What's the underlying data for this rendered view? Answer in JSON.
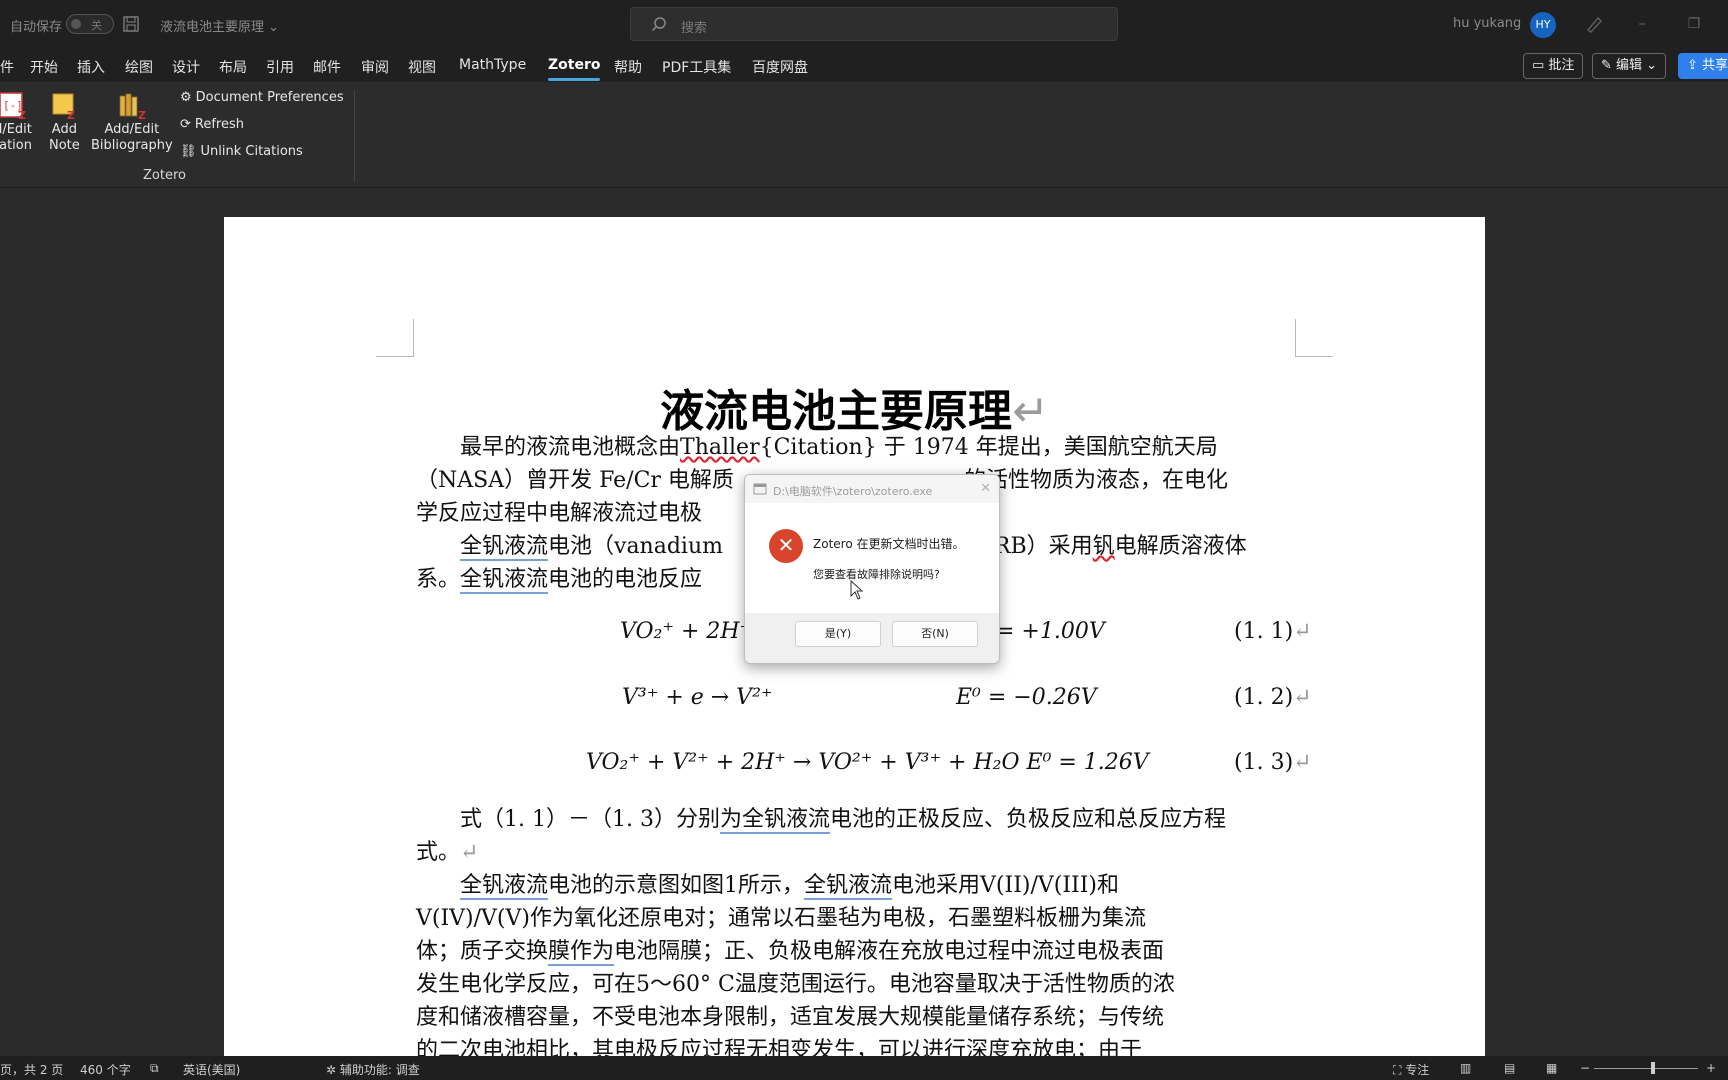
{
  "titlebar": {
    "autosave_label": "自动保存",
    "autosave_state": "关",
    "doc_name": "液流电池主要原理",
    "search_placeholder": "搜索",
    "user_name": "hu yukang",
    "avatar_initials": "HY"
  },
  "menu": {
    "items": [
      "件",
      "开始",
      "插入",
      "绘图",
      "设计",
      "布局",
      "引用",
      "邮件",
      "审阅",
      "视图",
      "MathType",
      "Zotero",
      "帮助",
      "PDF工具集",
      "百度网盘"
    ],
    "active": "Zotero",
    "comments_label": "批注",
    "edit_label": "编辑",
    "share_label": "共享"
  },
  "ribbon": {
    "add_edit_citation": [
      "d/Edit",
      "tation"
    ],
    "add_note": [
      "Add",
      "Note"
    ],
    "add_edit_bibliography": [
      "Add/Edit",
      "Bibliography"
    ],
    "document_preferences": "Document Preferences",
    "refresh": "Refresh",
    "unlink_citations": "Unlink Citations",
    "group_label": "Zotero"
  },
  "document": {
    "title": "液流电池主要原理",
    "p1_line1_a": "最早的液流电池概念由",
    "p1_line1_thaller": "Thaller",
    "p1_line1_b": "{Citation}",
    "p1_line1_c": "于 1974 年提出，美国航空航天局",
    "p1_line2_a": "（NASA）曾开发 Fe/Cr 电解质",
    "p1_line2_b": "的活性物质为液态，在电化",
    "p1_line3": "学反应过程中电解液流过电极",
    "p2_line1_a": "全钒液流",
    "p2_line1_b": "电池（vanadium",
    "p2_line1_c": "VRB）采用",
    "p2_line1_d": "钒",
    "p2_line1_e": "电解质溶液体",
    "p2_line2_a": "系。",
    "p2_line2_b": "全钒液流",
    "p2_line2_c": "电池的电池反应",
    "eq1_left": "VO₂⁺ + 2H⁺",
    "eq1_right": "= +1.00V",
    "eq1_no": "(1. 1)",
    "eq2_left": "V³⁺ + e → V²⁺",
    "eq2_right": "E⁰ = −0.26V",
    "eq2_no": "(1. 2)",
    "eq3": "VO₂⁺ + V²⁺ + 2H⁺ → VO²⁺ + V³⁺ + H₂O    E⁰ = 1.26V",
    "eq3_no": "(1. 3)",
    "p3_line1_a": "式（1. 1）－（1. 3）分别",
    "p3_line1_b": "为全钒液流",
    "p3_line1_c": "电池的正极反应、负极反应和总反应方程",
    "p3_line2": "式。",
    "p4_line1_a": "全钒液流",
    "p4_line1_b": "电池的示意图如图1所示，",
    "p4_line1_c": "全钒液流",
    "p4_line1_d": "电池采用V(II)/V(III)和",
    "p4_line2": "V(IV)/V(V)作为氧化还原电对；通常以石墨毡为电极，石墨塑料板栅为集流",
    "p4_line3_a": "体；质子交换",
    "p4_line3_b": "膜作为",
    "p4_line3_c": "电池隔膜；正、负极电解液在充放电过程中流过电极表面",
    "p4_line4": "发生电化学反应，可在5～60° C温度范围运行。电池容量取决于活性物质的浓",
    "p4_line5": "度和储液槽容量，不受电池本身限制，适宜发展大规模能量储存系统；与传统",
    "p4_line6": "的二次电池相比，其电极反应过程无相变发生，可以进行深度充放电；由于"
  },
  "dialog": {
    "title": "D:\\电脑软件\\zotero\\zotero.exe",
    "message1": "Zotero 在更新文档时出错。",
    "message2": "您要查看故障排除说明吗?",
    "yes_label": "是(Y)",
    "no_label": "否(N)"
  },
  "statusbar": {
    "page_info": "页，共 2 页",
    "word_count": "460 个字",
    "language": "英语(美国)",
    "accessibility": "辅助功能: 调查",
    "focus": "专注"
  },
  "colors": {
    "accent": "#4aa3df",
    "share_button": "#2f80ed",
    "error_icon": "#d9442c",
    "avatar": "#1565c0"
  }
}
